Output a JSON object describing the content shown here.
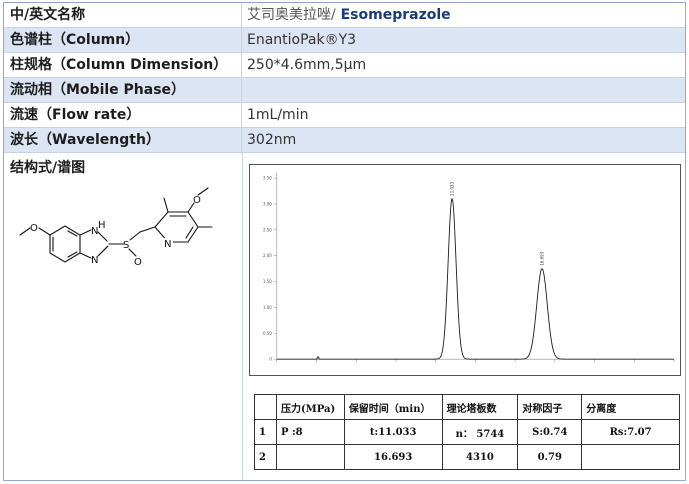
{
  "rows": [
    {
      "label": "中/英文名称",
      "value_cn": "艾司奥美拉唑/",
      "value_en": " Esomeprazole"
    },
    {
      "label": "色谱柱（Column）",
      "value": "EnantioPak®Y3"
    },
    {
      "label": "柱规格（Column Dimension）",
      "value": "250*4.6mm,5μm"
    },
    {
      "label": "流动相（Mobile Phase）",
      "value": ""
    },
    {
      "label": "流速（Flow rate）",
      "value": "1mL/min"
    },
    {
      "label": "波长（Wavelength）",
      "value": "302nm"
    }
  ],
  "structure_label": "结构式/谱图",
  "molecule": {
    "atoms": {
      "o1": "O",
      "n1": "N",
      "h1": "H",
      "n2": "N",
      "s": "S",
      "o2": "O",
      "o3": "O",
      "n3": "N"
    }
  },
  "chart_data": {
    "type": "line",
    "title": "",
    "xlabel": "",
    "ylabel": "",
    "x_ticks": [],
    "y_ticks": [
      "0",
      "0.50",
      "1.00",
      "1.50",
      "2.00",
      "2.50",
      "3.00",
      "3.50"
    ],
    "ylim": [
      0,
      3.6
    ],
    "xlim": [
      0,
      25
    ],
    "baseline": 0,
    "peaks": [
      {
        "time": 11.033,
        "height": 3.1,
        "width": 0.25,
        "label": "11.033"
      },
      {
        "time": 16.693,
        "height": 1.75,
        "width": 0.33,
        "label": "16.693"
      }
    ],
    "grid": false,
    "color": "#1a1a1a"
  },
  "results": {
    "headers": [
      "",
      "压力(MPa)",
      "保留时间（min）",
      "理论塔板数",
      "对称因子",
      "分离度"
    ],
    "rows": [
      [
        "1",
        "P :8",
        "t:11.033",
        "n：  5744",
        "S:0.74",
        "Rs:7.07"
      ],
      [
        "2",
        "",
        "16.693",
        "4310",
        "0.79",
        ""
      ]
    ]
  }
}
